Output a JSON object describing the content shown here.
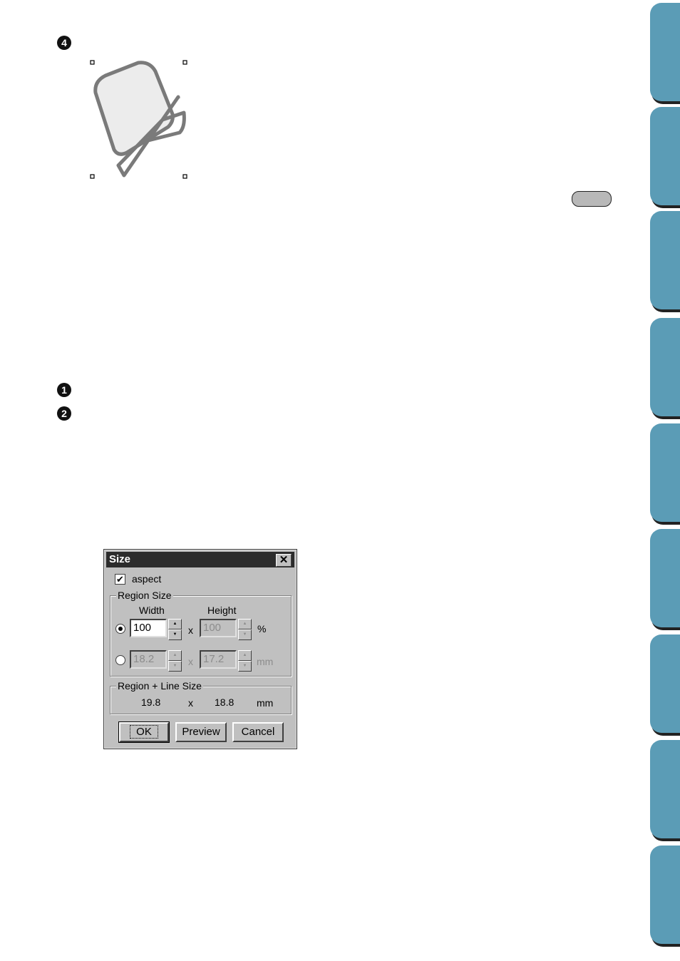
{
  "steps": {
    "step4": "4",
    "step1": "1",
    "step2": "2"
  },
  "side_tab_count": 9,
  "dialog": {
    "title": "Size",
    "close_glyph": "✕",
    "aspect_label": "aspect",
    "aspect_checked": true,
    "region_size_label": "Region Size",
    "width_label": "Width",
    "height_label": "Height",
    "percent_width": "100",
    "percent_height": "100",
    "percent_unit": "%",
    "mm_width": "18.2",
    "mm_height": "17.2",
    "mm_unit": "mm",
    "times": "x",
    "region_line_label": "Region + Line Size",
    "region_line_width": "19.8",
    "region_line_height": "18.8",
    "region_line_unit": "mm",
    "ok_label": "OK",
    "preview_label": "Preview",
    "cancel_label": "Cancel",
    "selected_mode": "percent"
  },
  "colors": {
    "tab": "#5b9cb6",
    "dialog_bg": "#c0c0c0",
    "shape_fill": "#ececec",
    "shape_stroke": "#7a7a7a"
  }
}
